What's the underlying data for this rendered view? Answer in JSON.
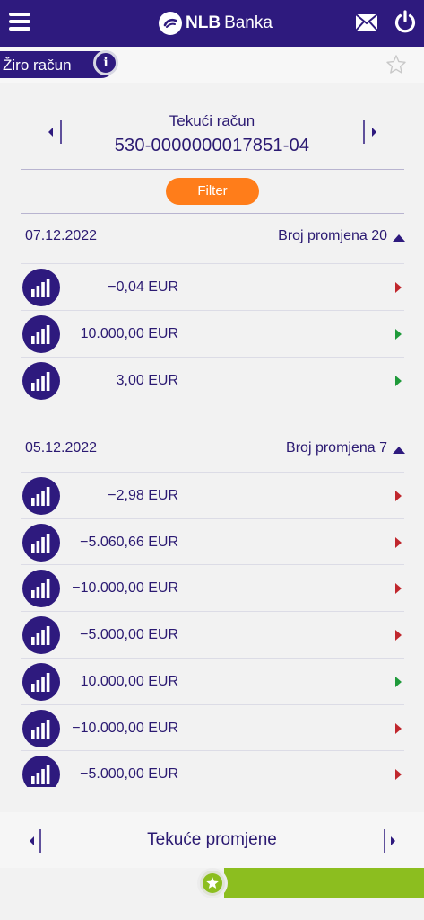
{
  "header": {
    "brand_bold": "NLB",
    "brand_light": "Banka",
    "menu_icon": "hamburger-menu-icon",
    "mail_icon": "envelope-icon",
    "power_icon": "power-icon"
  },
  "subbar": {
    "account_tab_label": "Žiro račun",
    "info_icon_glyph": "i",
    "favorite_icon": "star-outline-icon"
  },
  "account": {
    "type": "Tekući račun",
    "number": "530-0000000017851-04"
  },
  "filter_label": "Filter",
  "groups": [
    {
      "date": "07.12.2022",
      "count_label": "Broj promjena 20",
      "transactions": [
        {
          "amount": "−0,04 EUR",
          "direction": "out"
        },
        {
          "amount": "10.000,00 EUR",
          "direction": "in"
        },
        {
          "amount": "3,00 EUR",
          "direction": "in"
        }
      ]
    },
    {
      "date": "05.12.2022",
      "count_label": "Broj promjena 7",
      "transactions": [
        {
          "amount": "−2,98 EUR",
          "direction": "out"
        },
        {
          "amount": "−5.060,66 EUR",
          "direction": "out"
        },
        {
          "amount": "−10.000,00 EUR",
          "direction": "out"
        },
        {
          "amount": "−5.000,00 EUR",
          "direction": "out"
        },
        {
          "amount": "10.000,00 EUR",
          "direction": "in"
        },
        {
          "amount": "−10.000,00 EUR",
          "direction": "out"
        },
        {
          "amount": "−5.000,00 EUR",
          "direction": "out"
        }
      ]
    }
  ],
  "bottom_nav": {
    "title": "Tekuće promjene"
  },
  "colors": {
    "brand_purple": "#2e1a7e",
    "accent_orange": "#ff7d1a",
    "accent_green": "#8cbe1f",
    "arrow_out": "#c0272d",
    "arrow_in": "#1f9a3a"
  }
}
